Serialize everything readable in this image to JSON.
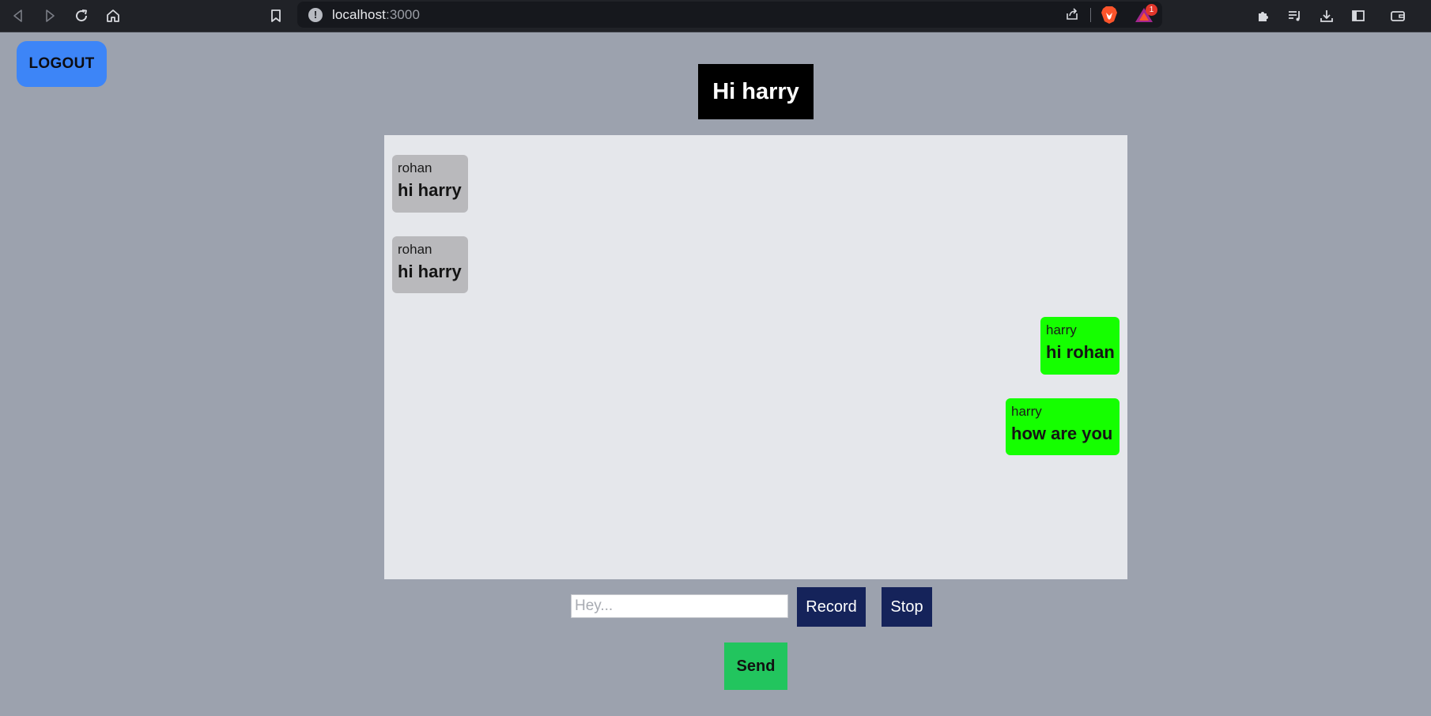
{
  "browser": {
    "url_host": "localhost",
    "url_port": ":3000",
    "rewards_badge": "1",
    "icons": [
      "back-icon",
      "forward-icon",
      "reload-icon",
      "home-icon",
      "bookmark-icon",
      "site-info-icon",
      "share-icon",
      "brave-shields-icon",
      "brave-rewards-icon",
      "extensions-icon",
      "playlist-icon",
      "downloads-icon",
      "sidebar-icon",
      "wallet-icon"
    ]
  },
  "header": {
    "logout_label": "LOGOUT",
    "greeting": "Hi harry"
  },
  "chat": {
    "messages": [
      {
        "sender": "rohan",
        "text": "hi harry",
        "direction": "received"
      },
      {
        "sender": "rohan",
        "text": "hi harry",
        "direction": "received"
      },
      {
        "sender": "harry",
        "text": "hi rohan",
        "direction": "sent"
      },
      {
        "sender": "harry",
        "text": "how are you",
        "direction": "sent"
      }
    ]
  },
  "composer": {
    "placeholder": "Hey...",
    "value": "",
    "record_label": "Record",
    "stop_label": "Stop",
    "send_label": "Send"
  },
  "colors": {
    "page_bg": "#9ca2ae",
    "chat_bg": "#e5e7eb",
    "received_bubble": "#b9b9bc",
    "sent_bubble": "#15ff00",
    "logout_bg": "#3d85f7",
    "dark_button": "#15235a",
    "send_button": "#22c55e"
  }
}
